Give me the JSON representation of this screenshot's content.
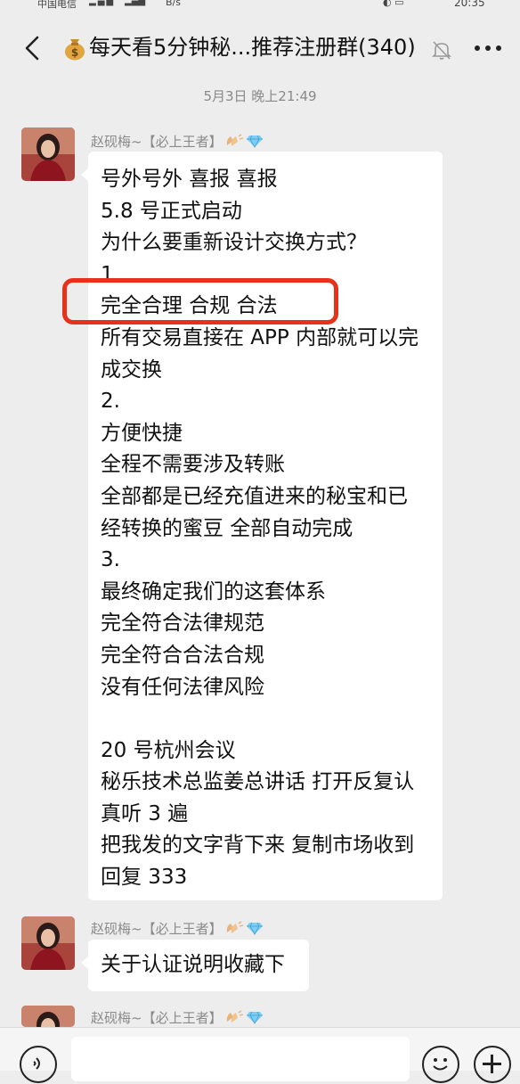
{
  "status_bar": {
    "carrier": "中国电信",
    "speed": "B/s",
    "time": "20:35"
  },
  "header": {
    "title": "每天看5分钟秘...推荐注册群(340)",
    "back_icon": "chevron-left-icon",
    "title_icon": "money-bag-icon",
    "mute_icon": "bell-off-icon",
    "more_icon": "more-dots-icon"
  },
  "timestamp": "5月3日 晚上21:49",
  "messages": [
    {
      "sender": "赵砚梅~【必上王者】",
      "sender_emojis": [
        "clapping-hands-icon",
        "gem-icon"
      ],
      "lines": [
        "号外号外 喜报 喜报",
        "5.8 号正式启动",
        "为什么要重新设计交换方式？",
        "1.",
        "完全合理 合规 合法",
        "所有交易直接在 APP 内部就可以完",
        "成交换",
        "2.",
        "方便快捷",
        "全程不需要涉及转账",
        "全部都是已经充值进来的秘宝和已",
        "经转换的蜜豆 全部自动完成",
        "3.",
        "最终确定我们的这套体系",
        "完全符合法律规范",
        "完全符合合法合规",
        "没有任何法律风险",
        "",
        "20 号杭州会议",
        "秘乐技术总监姜总讲话 打开反复认",
        "真听 3 遍",
        "把我发的文字背下来 复制市场收到",
        "回复 333"
      ]
    },
    {
      "sender": "赵砚梅~【必上王者】",
      "sender_emojis": [
        "clapping-hands-icon",
        "gem-icon"
      ],
      "lines": [
        "关于认证说明收藏下"
      ]
    },
    {
      "sender": "赵砚梅~【必上王者】",
      "sender_emojis": [
        "clapping-hands-icon",
        "gem-icon"
      ],
      "lines": []
    }
  ],
  "annotation": {
    "color": "#e8311a"
  },
  "input_bar": {
    "voice_icon": "voice-icon",
    "emoji_icon": "emoji-icon",
    "plus_icon": "plus-icon"
  }
}
